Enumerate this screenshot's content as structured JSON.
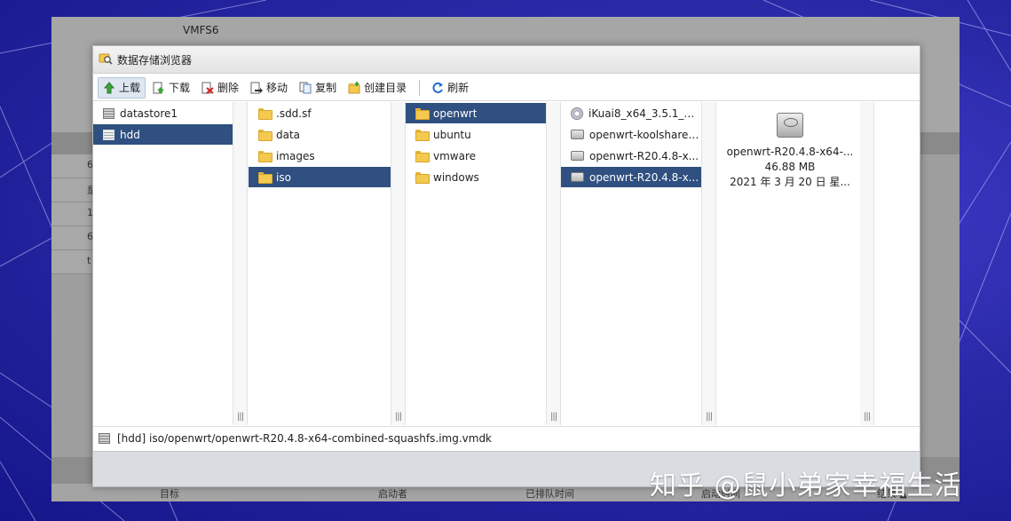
{
  "background": {
    "vmfs_label": "VMFS6",
    "row_glyphs": [
      "6",
      "是",
      "1",
      "6",
      "t"
    ],
    "columns": [
      "目标",
      "启动者",
      "已排队时间",
      "启动时间",
      "结果 ▲"
    ]
  },
  "dialog": {
    "title": "数据存储浏览器",
    "toolbar": {
      "upload": "上载",
      "download": "下载",
      "delete": "删除",
      "move": "移动",
      "copy": "复制",
      "create_dir": "创建目录",
      "refresh": "刷新"
    },
    "datastores": [
      "datastore1",
      "hdd"
    ],
    "root_folders": [
      ".sdd.sf",
      "data",
      "images",
      "iso"
    ],
    "iso_folders": [
      "openwrt",
      "ubuntu",
      "vmware",
      "windows"
    ],
    "files": [
      "iKuai8_x64_3.5.1_B...",
      "openwrt-koolshare-...",
      "openwrt-R20.4.8-x...",
      "openwrt-R20.4.8-x..."
    ],
    "preview": {
      "name": "openwrt-R20.4.8-x64-...",
      "size": "46.88 MB",
      "date": "2021 年 3 月 20 日 星..."
    },
    "path": "[hdd] iso/openwrt/openwrt-R20.4.8-x64-combined-squashfs.img.vmdk"
  },
  "watermark": "知乎 @鼠小弟家幸福生活",
  "colors": {
    "selection": "#2f5080",
    "background_blue": "#2a2aa8"
  }
}
